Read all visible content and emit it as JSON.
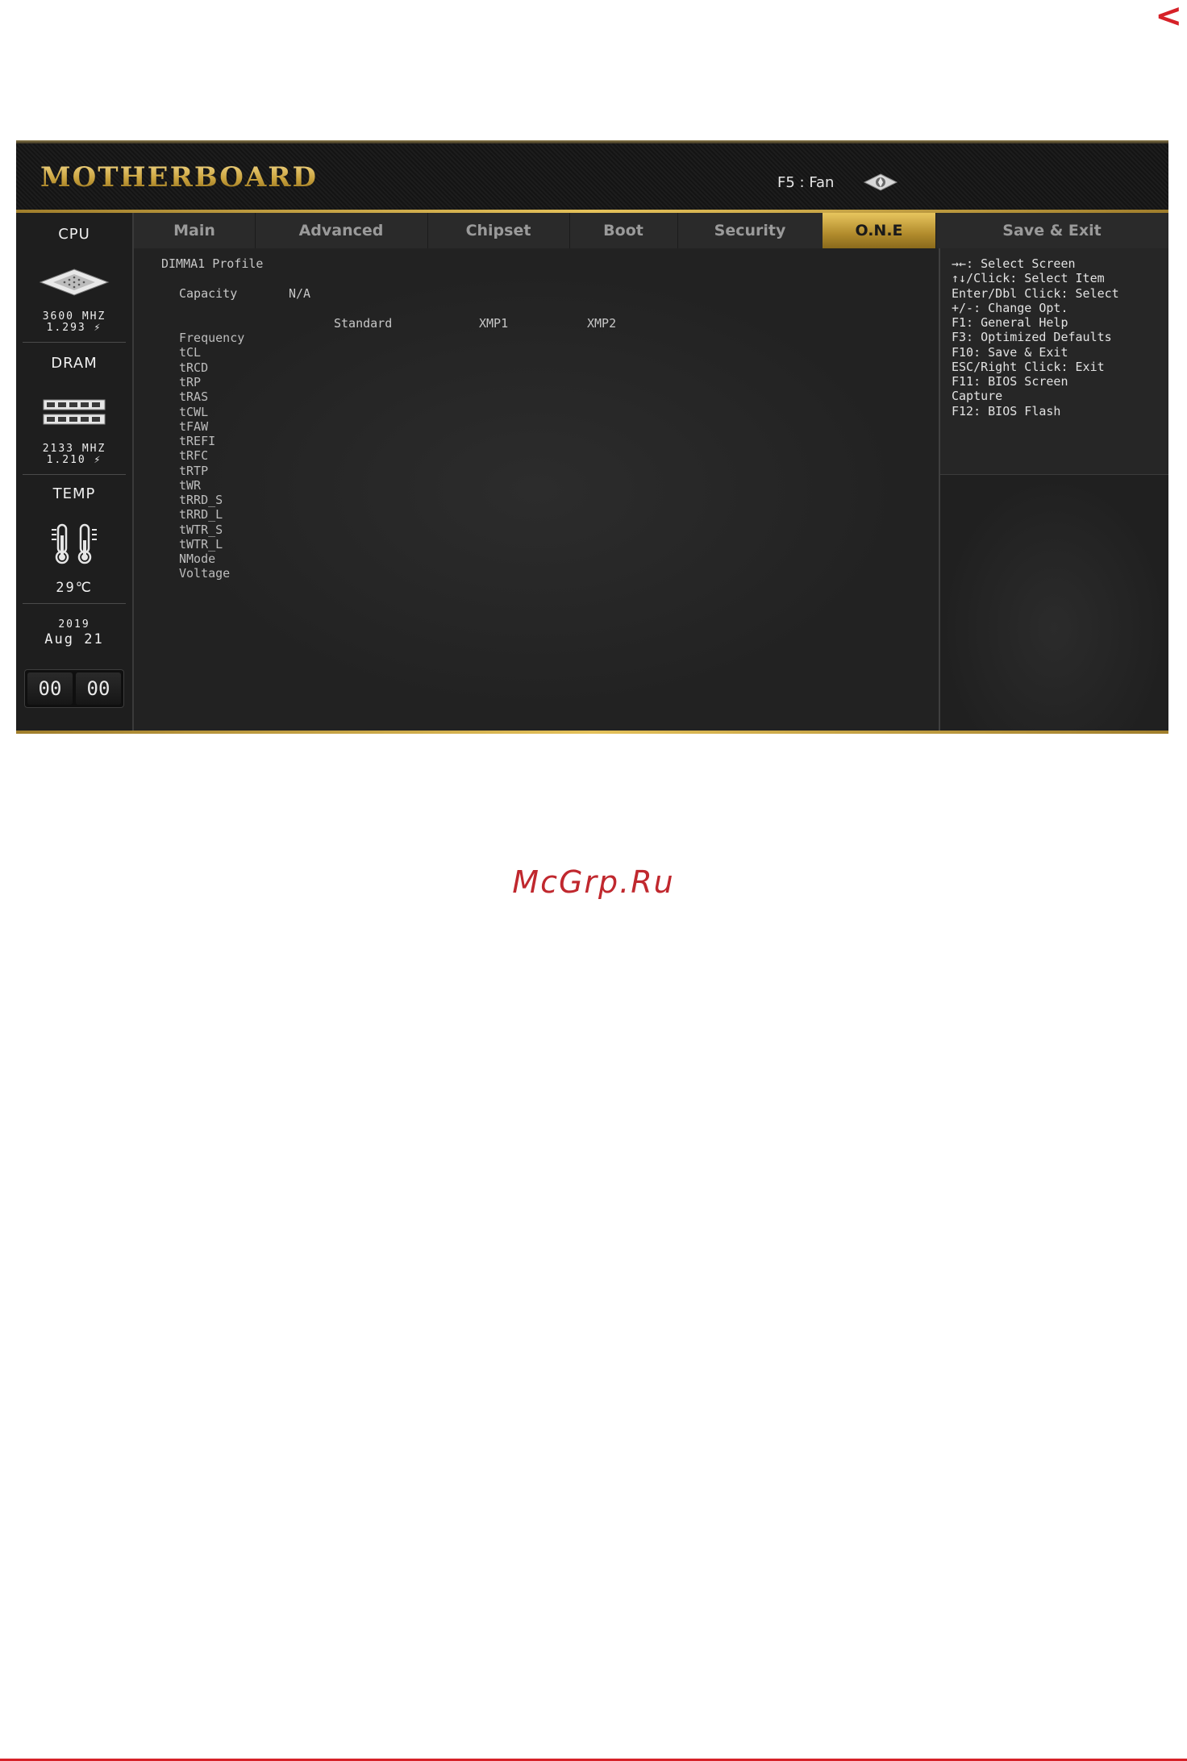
{
  "corner_arrow": "<",
  "header": {
    "logo": "MOTHERBOARD",
    "f5_label": "F5 : Fan"
  },
  "tabs": [
    {
      "label": "Main",
      "active": false
    },
    {
      "label": "Advanced",
      "active": false
    },
    {
      "label": "Chipset",
      "active": false
    },
    {
      "label": "Boot",
      "active": false
    },
    {
      "label": "Security",
      "active": false
    },
    {
      "label": "O.N.E",
      "active": true
    },
    {
      "label": "Save & Exit",
      "active": false
    }
  ],
  "sidebar": {
    "cpu": {
      "title": "CPU",
      "freq": "3600 MHZ",
      "volt": "1.293 ⚡"
    },
    "dram": {
      "title": "DRAM",
      "freq": "2133 MHZ",
      "volt": "1.210 ⚡"
    },
    "temp": {
      "title": "TEMP",
      "value": "29℃"
    },
    "date": {
      "year": "2019",
      "month_day": "Aug 21"
    },
    "clock": {
      "hours": "00",
      "minutes": "00"
    }
  },
  "content": {
    "section_title": "DIMMA1 Profile",
    "capacity_label": "Capacity",
    "capacity_value": "N/A",
    "columns": [
      "Standard",
      "XMP1",
      "XMP2"
    ],
    "params": [
      "Frequency",
      "tCL",
      "tRCD",
      "tRP",
      "tRAS",
      "tCWL",
      "tFAW",
      "tREFI",
      "tRFC",
      "tRTP",
      "tWR",
      "tRRD_S",
      "tRRD_L",
      "tWTR_S",
      "tWTR_L",
      "NMode",
      "Voltage"
    ]
  },
  "help": [
    "→←: Select Screen",
    "↑↓/Click: Select Item",
    "Enter/Dbl Click: Select",
    "+/-: Change Opt.",
    "F1: General Help",
    "F3: Optimized Defaults",
    "F10: Save & Exit",
    "ESC/Right Click: Exit",
    "F11: BIOS Screen",
    "Capture",
    "F12: BIOS Flash"
  ],
  "watermark": "McGrp.Ru",
  "colors": {
    "accent_gold": "#e4c15a",
    "brand_red": "#d62128",
    "panel_bg": "#232323"
  }
}
